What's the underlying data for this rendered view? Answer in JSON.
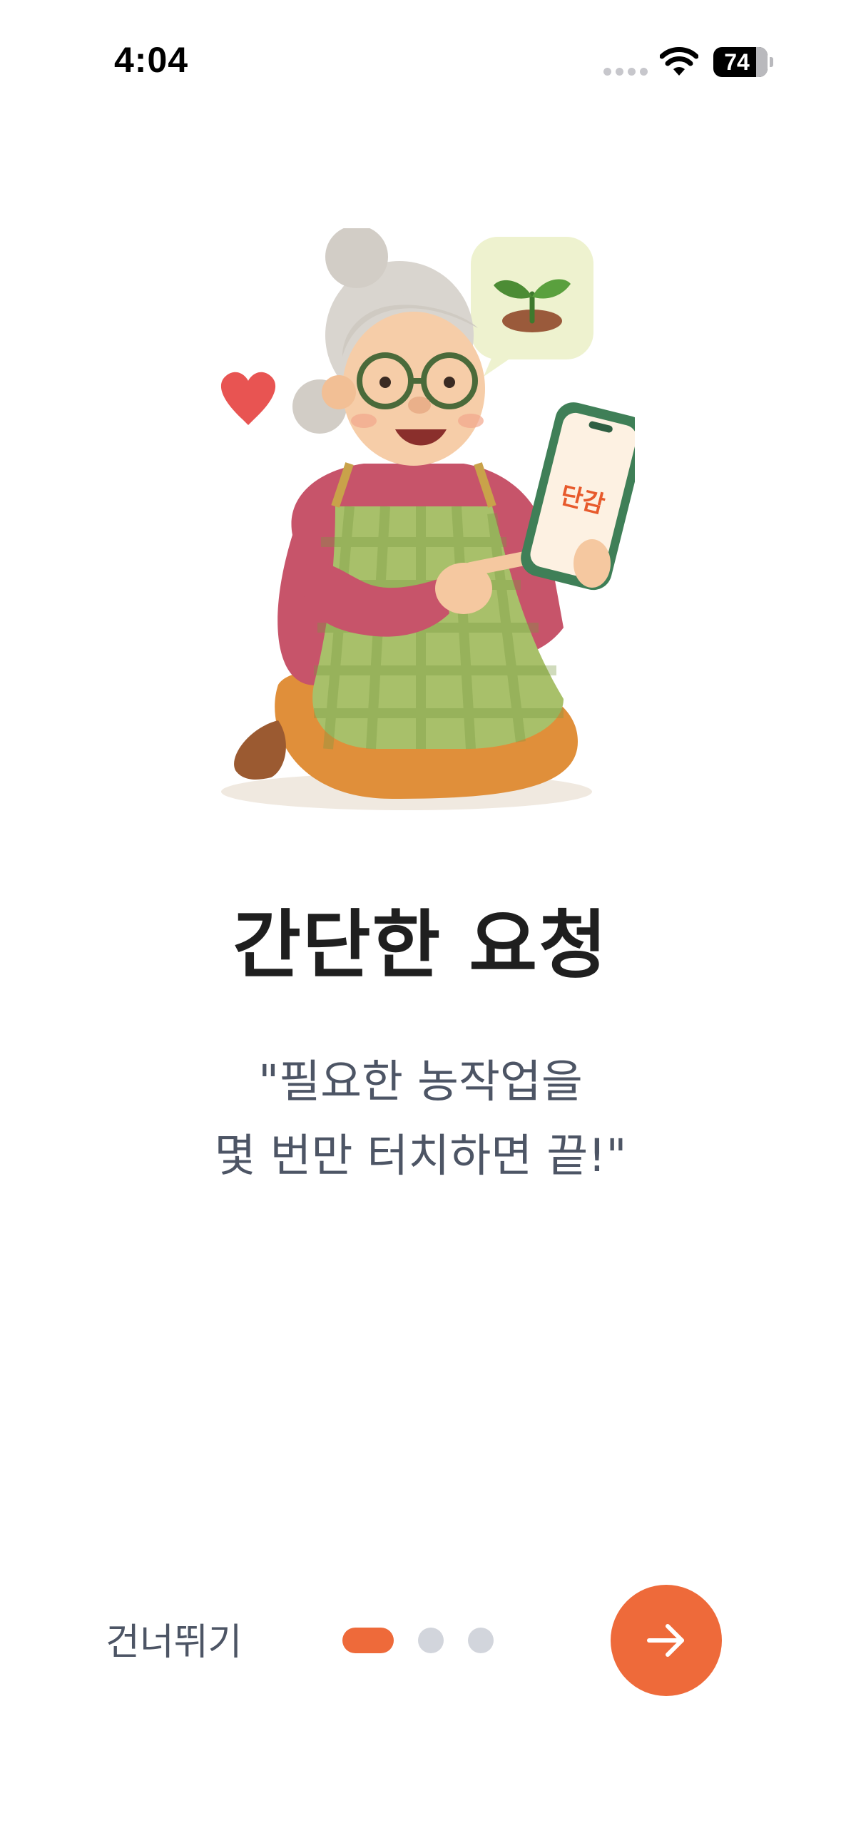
{
  "status_bar": {
    "time": "4:04",
    "battery_level": "74",
    "icons": [
      "cellular-dots-icon",
      "wifi-icon",
      "battery-icon"
    ]
  },
  "illustration": {
    "description_icon_names": [
      "heart-icon",
      "sprout-speech-bubble-icon",
      "grandmother-with-phone-illustration"
    ],
    "phone_screen_text": "단감"
  },
  "onboarding": {
    "title": "간단한 요청",
    "description_line1": "\"필요한 농작업을",
    "description_line2": "몇 번만 터치하면 끝!\"",
    "current_page": 1,
    "total_pages": 3
  },
  "controls": {
    "skip_label": "건너뛰기",
    "next_icon": "arrow-right-icon"
  },
  "colors": {
    "accent": "#ee6a3a",
    "title": "#1f1f1f",
    "body_text": "#4d5565",
    "inactive_dot": "#d2d5dc",
    "background": "#ffffff"
  }
}
